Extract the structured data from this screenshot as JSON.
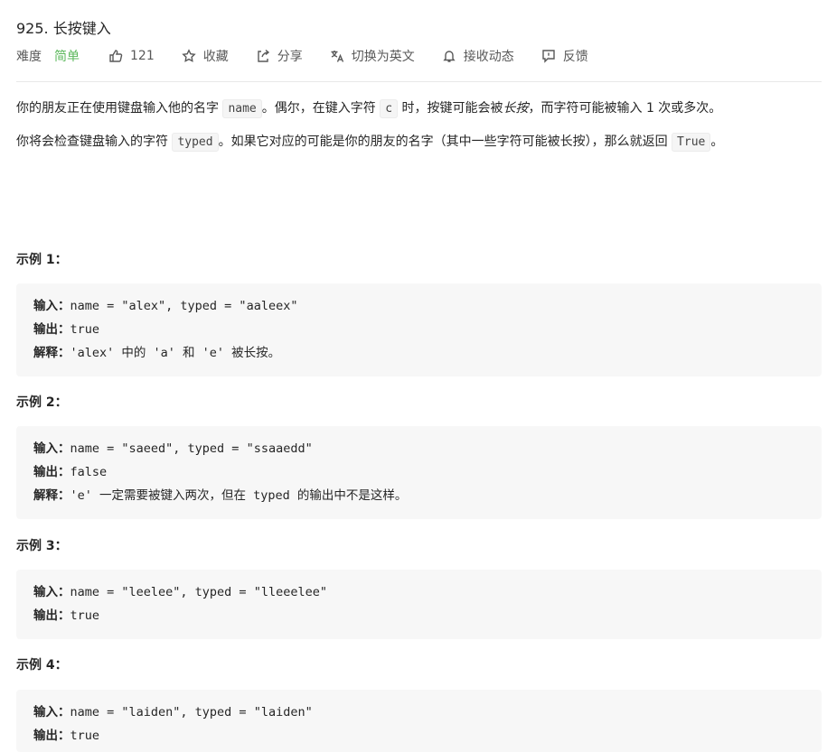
{
  "problem": {
    "title": "925. 长按键入",
    "toolbar": {
      "difficulty_label": "难度",
      "difficulty_value": "简单",
      "likes": "121",
      "favorite": "收藏",
      "share": "分享",
      "switch_lang": "切换为英文",
      "notify": "接收动态",
      "feedback": "反馈"
    },
    "desc": {
      "p1_a": "你的朋友正在使用键盘输入他的名字",
      "p1_code1": "name",
      "p1_b": "。偶尔，在键入字符",
      "p1_code2": "c",
      "p1_c": "时，按键可能会被",
      "p1_em": "长按",
      "p1_d": "，而字符可能被输入 1 次或多次。",
      "p2_a": "你将会检查键盘输入的字符",
      "p2_code1": "typed",
      "p2_b": "。如果它对应的可能是你的朋友的名字（其中一些字符可能被长按），那么就返回",
      "p2_code2": "True",
      "p2_c": "。"
    },
    "examples": [
      {
        "heading": "示例 1：",
        "input_key": "输入：",
        "input": "name = \"alex\", typed = \"aaleex\"",
        "output_key": "输出：",
        "output": "true",
        "explain_key": "解释：",
        "explain": "'alex' 中的 'a' 和 'e' 被长按。"
      },
      {
        "heading": "示例 2：",
        "input_key": "输入：",
        "input": "name = \"saeed\", typed = \"ssaaedd\"",
        "output_key": "输出：",
        "output": "false",
        "explain_key": "解释：",
        "explain": "'e' 一定需要被键入两次，但在 typed 的输出中不是这样。"
      },
      {
        "heading": "示例 3：",
        "input_key": "输入：",
        "input": "name = \"leelee\", typed = \"lleeelee\"",
        "output_key": "输出：",
        "output": "true"
      },
      {
        "heading": "示例 4：",
        "input_key": "输入：",
        "input": "name = \"laiden\", typed = \"laiden\"",
        "output_key": "输出：",
        "output": "true"
      }
    ]
  }
}
